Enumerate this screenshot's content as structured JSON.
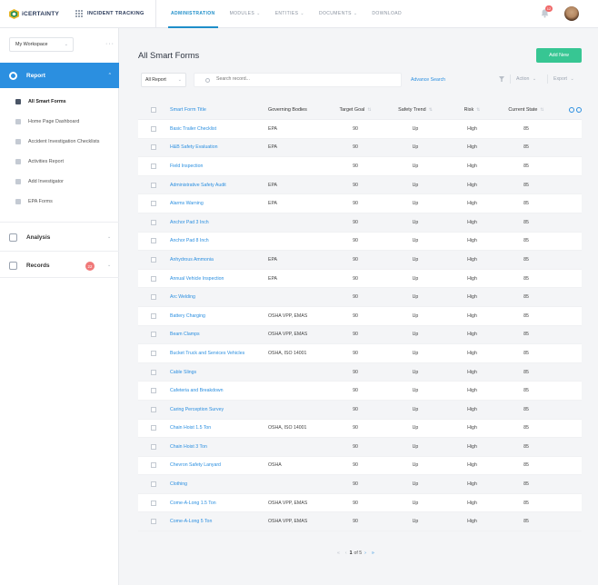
{
  "topbar": {
    "logo_text": "iCERTAINTY",
    "product": "INCIDENT TRACKING",
    "nav": [
      {
        "label": "ADMINISTRATION",
        "active": true,
        "caret": false
      },
      {
        "label": "MODULES",
        "caret": true
      },
      {
        "label": "ENTITIES",
        "caret": true
      },
      {
        "label": "DOCUMENTS",
        "caret": true
      },
      {
        "label": "DOWNLOAD",
        "caret": false
      }
    ],
    "notification_count": "12",
    "icons": {
      "apps": "grid-icon",
      "bell": "bell-icon",
      "avatar": "user-avatar"
    }
  },
  "sidebar": {
    "workspace": "My Workspace",
    "more": "···",
    "report_label": "Report",
    "report_items": [
      {
        "label": "All Smart Forms",
        "active": true
      },
      {
        "label": "Home Page Dashboard"
      },
      {
        "label": "Accident Investigation Checklists"
      },
      {
        "label": "Activities Report"
      },
      {
        "label": "Add Investigator"
      },
      {
        "label": "EPA Forms"
      }
    ],
    "analysis_label": "Analysis",
    "records_label": "Records",
    "records_badge": "22"
  },
  "main": {
    "title": "All Smart Forms",
    "add_button": "Add New",
    "filter_value": "All Report",
    "search_placeholder": "Search record...",
    "advance_search": "Advance Search",
    "action_label": "Action",
    "export_label": "Export",
    "columns": [
      "Smart Form Title",
      "Governing Bodies",
      "Target Goal",
      "Safety Trend",
      "Risk",
      "Current State"
    ],
    "rows": [
      {
        "title": "Basic Trailer Checklist",
        "gov": "EPA",
        "goal": "90",
        "trend": "Up",
        "risk": "High",
        "state": "85"
      },
      {
        "title": "H&B Safety Evaluation",
        "gov": "EPA",
        "goal": "90",
        "trend": "Up",
        "risk": "High",
        "state": "85"
      },
      {
        "title": "Field Inspection",
        "gov": "",
        "goal": "90",
        "trend": "Up",
        "risk": "High",
        "state": "85"
      },
      {
        "title": "Administrative Safety Audit",
        "gov": "EPA",
        "goal": "90",
        "trend": "Up",
        "risk": "High",
        "state": "85"
      },
      {
        "title": "Alarms Warning",
        "gov": "EPA",
        "goal": "90",
        "trend": "Up",
        "risk": "High",
        "state": "85"
      },
      {
        "title": "Anchor Pad 3 Inch",
        "gov": "",
        "goal": "90",
        "trend": "Up",
        "risk": "High",
        "state": "85"
      },
      {
        "title": "Anchor Pad 8 Inch",
        "gov": "",
        "goal": "90",
        "trend": "Up",
        "risk": "High",
        "state": "85"
      },
      {
        "title": "Anhydrous Ammonia",
        "gov": "EPA",
        "goal": "90",
        "trend": "Up",
        "risk": "High",
        "state": "85"
      },
      {
        "title": "Annual Vehicle Inspection",
        "gov": "EPA",
        "goal": "90",
        "trend": "Up",
        "risk": "High",
        "state": "85"
      },
      {
        "title": "Arc Welding",
        "gov": "",
        "goal": "90",
        "trend": "Up",
        "risk": "High",
        "state": "85"
      },
      {
        "title": "Battery Charging",
        "gov": "OSHA VPP, EMAS",
        "goal": "90",
        "trend": "Up",
        "risk": "High",
        "state": "85"
      },
      {
        "title": "Beam Clamps",
        "gov": "OSHA VPP, EMAS",
        "goal": "90",
        "trend": "Up",
        "risk": "High",
        "state": "85"
      },
      {
        "title": "Bucket Truck and Services Vehicles",
        "gov": "OSHA, ISO 14001",
        "goal": "90",
        "trend": "Up",
        "risk": "High",
        "state": "85"
      },
      {
        "title": "Cable Slings",
        "gov": "",
        "goal": "90",
        "trend": "Up",
        "risk": "High",
        "state": "85"
      },
      {
        "title": "Cafeteria and Breakdown",
        "gov": "",
        "goal": "90",
        "trend": "Up",
        "risk": "High",
        "state": "85"
      },
      {
        "title": "Caring Perception Survey",
        "gov": "",
        "goal": "90",
        "trend": "Up",
        "risk": "High",
        "state": "85"
      },
      {
        "title": "Chain Hoist 1.5 Ton",
        "gov": "OSHA, ISO 14001",
        "goal": "90",
        "trend": "Up",
        "risk": "High",
        "state": "85"
      },
      {
        "title": "Chain Hoist 3 Ton",
        "gov": "",
        "goal": "90",
        "trend": "Up",
        "risk": "High",
        "state": "85"
      },
      {
        "title": "Chevron Safety Lanyard",
        "gov": "OSHA",
        "goal": "90",
        "trend": "Up",
        "risk": "High",
        "state": "85"
      },
      {
        "title": "Clothing",
        "gov": "",
        "goal": "90",
        "trend": "Up",
        "risk": "High",
        "state": "85"
      },
      {
        "title": "Come-A-Long 1.5 Ton",
        "gov": "OSHA VPP, EMAS",
        "goal": "90",
        "trend": "Up",
        "risk": "High",
        "state": "85"
      },
      {
        "title": "Come-A-Long 5 Ton",
        "gov": "OSHA VPP, EMAS",
        "goal": "90",
        "trend": "Up",
        "risk": "High",
        "state": "85"
      }
    ],
    "pagination": {
      "current": "1",
      "of_text": "of 5"
    }
  },
  "colors": {
    "accent": "#2b8fe0",
    "add_button": "#37c693",
    "badge": "#f06a6a"
  }
}
